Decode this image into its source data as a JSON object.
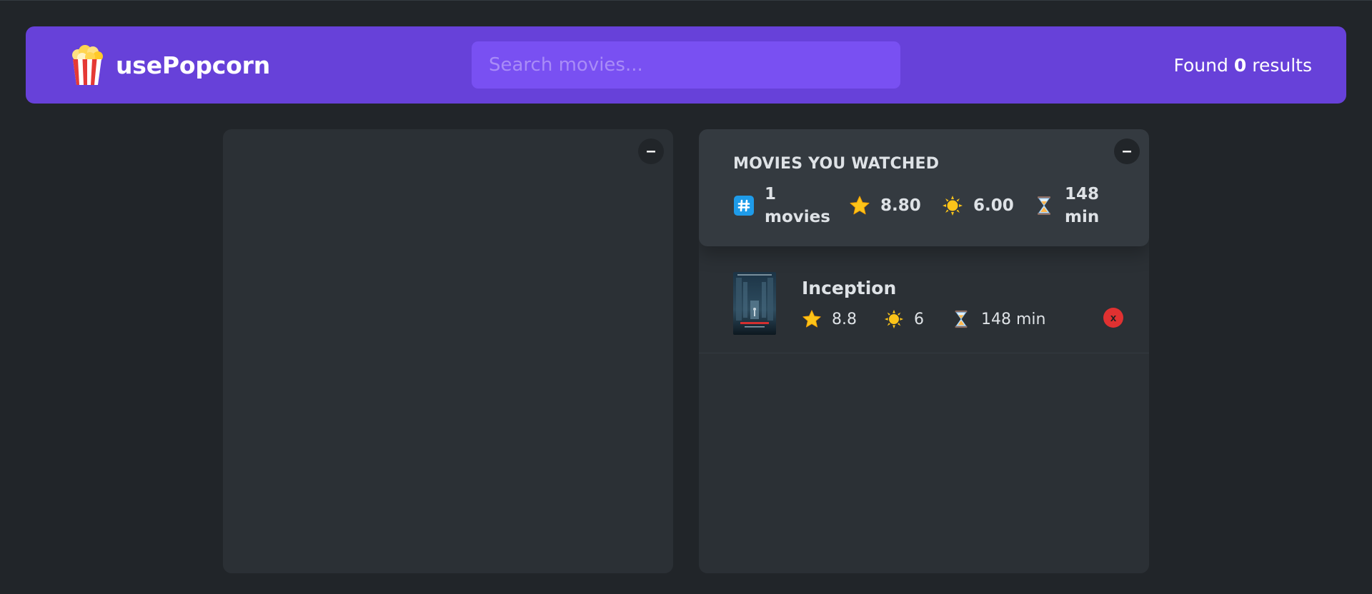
{
  "nav": {
    "logo_text": "usePopcorn",
    "search_placeholder": "Search movies...",
    "search_value": "",
    "results_prefix": "Found",
    "results_count": "0",
    "results_suffix": "results"
  },
  "left_box": {
    "toggle_label": "–"
  },
  "right_box": {
    "toggle_label": "–",
    "summary": {
      "title": "Movies you watched",
      "count_text": "1 movies",
      "avg_imdb": "8.80",
      "avg_user": "6.00",
      "avg_runtime": "148 min"
    },
    "watched": [
      {
        "title": "Inception",
        "imdb_rating": "8.8",
        "user_rating": "6",
        "runtime": "148 min",
        "delete_label": "x"
      }
    ]
  },
  "colors": {
    "background": "#212529",
    "nav": "#6741d9",
    "search": "#7950f2",
    "box": "#2b3035",
    "summary": "#343a40",
    "delete": "#e03131"
  },
  "icons": {
    "logo": "popcorn-icon",
    "count": "hash-icon",
    "imdb": "star-icon",
    "user": "sun-icon",
    "runtime": "hourglass-icon"
  }
}
